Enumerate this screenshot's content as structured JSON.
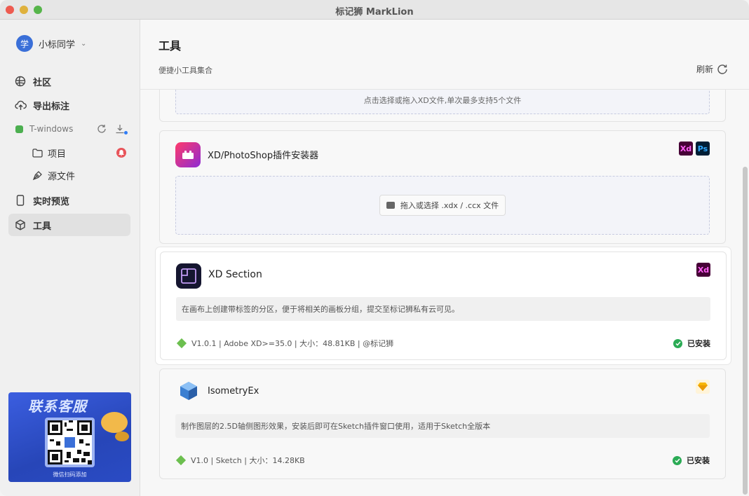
{
  "window": {
    "title": "标记狮 MarkLion"
  },
  "sidebar": {
    "user": {
      "avatar_text": "学",
      "name": "小标同学",
      "chevron": "⌄"
    },
    "nav": [
      {
        "label": "社区",
        "icon": "globe-icon"
      },
      {
        "label": "导出标注",
        "icon": "cloud-upload-icon"
      }
    ],
    "team": {
      "name": "T-windows",
      "color": "#4caf50"
    },
    "team_items": [
      {
        "label": "项目",
        "icon": "folder-icon"
      },
      {
        "label": "源文件",
        "icon": "pen-tool-icon"
      }
    ],
    "nav_bottom": [
      {
        "label": "实时预览",
        "icon": "phone-icon"
      },
      {
        "label": "工具",
        "icon": "cube-icon",
        "active": true
      }
    ],
    "promo": {
      "title": "联系客服",
      "sub": "微信扫码添加"
    }
  },
  "main": {
    "title": "工具",
    "subtitle": "便捷小工具集合",
    "refresh_label": "刷新",
    "cards": {
      "top_dropzone_text": "点击选择或拖入XD文件,单次最多支持5个文件",
      "installer": {
        "name": "XD/PhotoShop插件安装器",
        "badges": [
          "Xd",
          "Ps"
        ],
        "drop_button": "拖入或选择 .xdx / .ccx 文件"
      },
      "xd_section": {
        "name": "XD Section",
        "badge": "Xd",
        "description": "在画布上创建带标签的分区，便于将相关的画板分组，提交至标记狮私有云可见。",
        "meta": "V1.0.1 | Adobe XD>=35.0 | 大小：48.81KB | @标记狮",
        "status": "已安装"
      },
      "isometry": {
        "name": "IsometryEx",
        "description": "制作图层的2.5D轴侧图形效果，安装后即可在Sketch插件窗口使用，适用于Sketch全版本",
        "meta": "V1.0 | Sketch | 大小：14.28KB",
        "status": "已安装"
      }
    }
  }
}
